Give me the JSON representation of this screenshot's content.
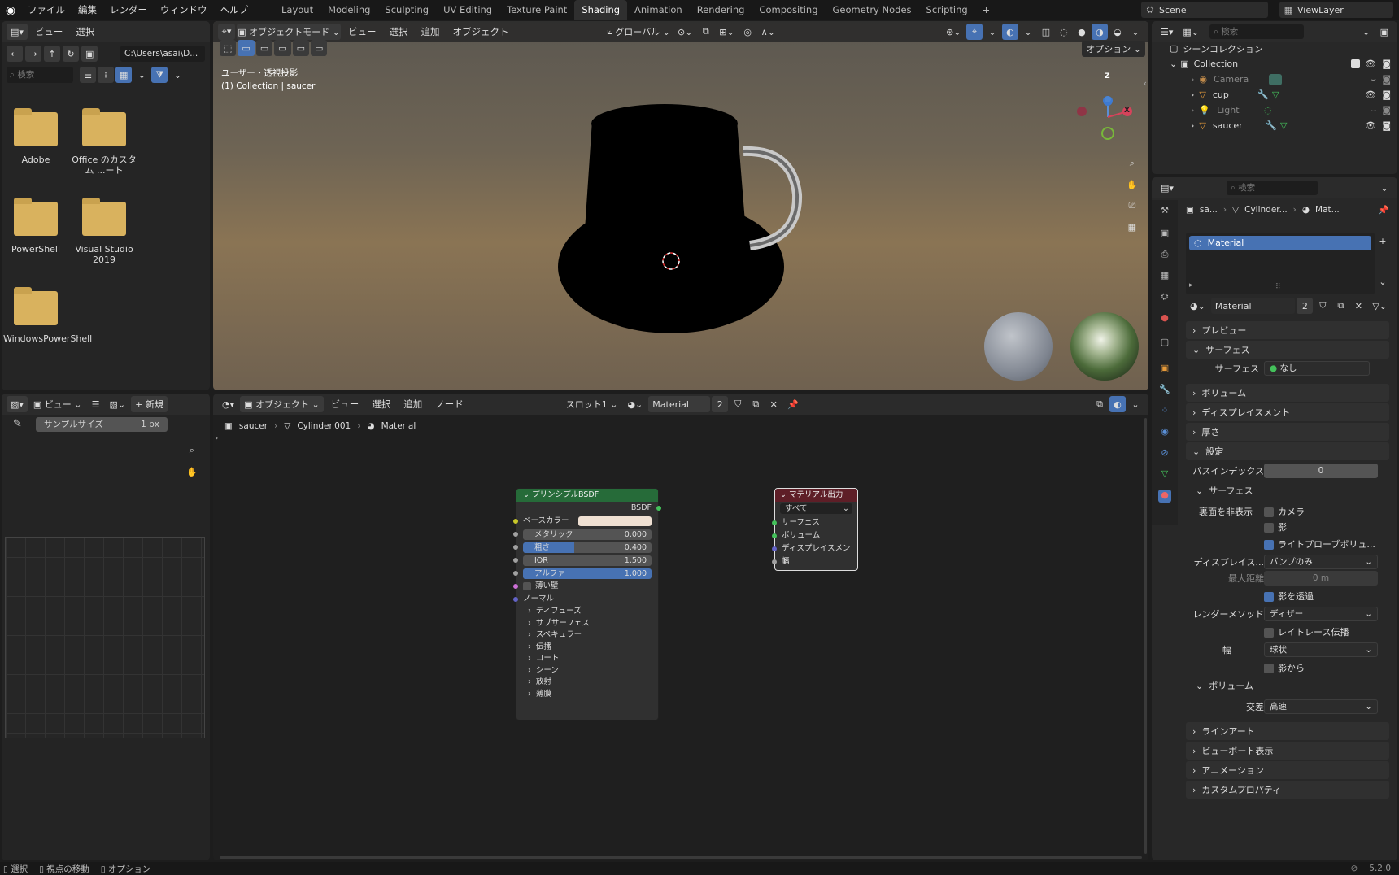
{
  "topbar": {
    "menus": [
      "ファイル",
      "編集",
      "レンダー",
      "ウィンドウ",
      "ヘルプ"
    ],
    "workspaces": [
      "Layout",
      "Modeling",
      "Sculpting",
      "UV Editing",
      "Texture Paint",
      "Shading",
      "Animation",
      "Rendering",
      "Compositing",
      "Geometry Nodes",
      "Scripting"
    ],
    "active_workspace": "Shading",
    "add_tab": "+",
    "scene": "Scene",
    "view_layer": "ViewLayer"
  },
  "file_browser": {
    "menus": [
      "ビュー",
      "選択"
    ],
    "path": "C:\\Users\\asai\\D...",
    "search_placeholder": "検索",
    "folders": [
      "Adobe",
      "Office のカスタム ...ート",
      "PowerShell",
      "Visual Studio 2019",
      "WindowsPowerShell"
    ]
  },
  "viewport": {
    "mode": "オブジェクトモード",
    "menus": [
      "ビュー",
      "選択",
      "追加",
      "オブジェクト"
    ],
    "transform": "グローバル",
    "options": "オプション",
    "info_line1": "ユーザー・透視投影",
    "info_line2": "(1) Collection | saucer",
    "gizmo_z": "Z",
    "gizmo_x": "X"
  },
  "image_editor": {
    "menu": "ビュー",
    "new_label": "新規",
    "sample_size_label": "サンプルサイズ",
    "sample_size_value": "1 px"
  },
  "node_editor": {
    "mode": "オブジェクト",
    "menus": [
      "ビュー",
      "選択",
      "追加",
      "ノード"
    ],
    "slot": "スロット1",
    "material": "Material",
    "users": "2",
    "breadcrumb": [
      "saucer",
      "Cylinder.001",
      "Material"
    ],
    "bsdf_node": {
      "title": "プリンシプルBSDF",
      "output": "BSDF",
      "base_color_label": "ベースカラー",
      "base_color": "#efe0d2",
      "fields": [
        {
          "label": "メタリック",
          "value": "0.000",
          "blue": false,
          "fill": 0
        },
        {
          "label": "粗さ",
          "value": "0.400",
          "blue": true,
          "fill": 0.4
        },
        {
          "label": "IOR",
          "value": "1.500",
          "blue": false,
          "fill": 0
        },
        {
          "label": "アルファ",
          "value": "1.000",
          "blue": true,
          "fill": 1
        }
      ],
      "thin_wall": "薄い壁",
      "normal": "ノーマル",
      "panels": [
        "ディフューズ",
        "サブサーフェス",
        "スペキュラー",
        "伝播",
        "コート",
        "シーン",
        "放射",
        "薄膜"
      ]
    },
    "output_node": {
      "title": "マテリアル出力",
      "target": "すべて",
      "inputs": [
        "サーフェス",
        "ボリューム",
        "ディスプレイスメント",
        "幅"
      ]
    }
  },
  "outliner": {
    "search_placeholder": "検索",
    "scene_collection": "シーンコレクション",
    "collection": "Collection",
    "items": [
      "Camera",
      "cup",
      "Light",
      "saucer"
    ]
  },
  "properties": {
    "search_placeholder": "検索",
    "breadcrumb": [
      "sa...",
      "Cylinder...",
      "Mat..."
    ],
    "slot_name": "Material",
    "material_name": "Material",
    "users": "2",
    "sections": {
      "preview": "プレビュー",
      "surface": "サーフェス",
      "surface_label": "サーフェス",
      "surface_value": "なし",
      "volume": "ボリューム",
      "displacement": "ディスプレイスメント",
      "thickness": "厚さ",
      "settings": "設定",
      "pass_index_label": "パスインデックス",
      "pass_index_value": "0",
      "sub_surface": "サーフェス",
      "backface_label": "裏面を非表示",
      "backface_camera": "カメラ",
      "backface_shadow": "影",
      "light_probe": "ライトプローブボリュ...",
      "disp_label": "ディスプレイス...",
      "disp_value": "バンプのみ",
      "max_dist_label": "最大距離",
      "max_dist_value": "0 m",
      "transparent_shadow": "影を透過",
      "render_method_label": "レンダーメソッド",
      "render_method_value": "ディザー",
      "raytrace": "レイトレース伝播",
      "width_label": "幅",
      "width_value": "球状",
      "from_shadow": "影から",
      "sub_volume": "ボリューム",
      "intersect_label": "交差",
      "intersect_value": "高速",
      "lineart": "ラインアート",
      "viewport_display": "ビューポート表示",
      "animation": "アニメーション",
      "custom_props": "カスタムプロパティ"
    }
  },
  "statusbar": {
    "select": "選択",
    "move_view": "視点の移動",
    "options": "オプション",
    "version": "5.2.0"
  }
}
